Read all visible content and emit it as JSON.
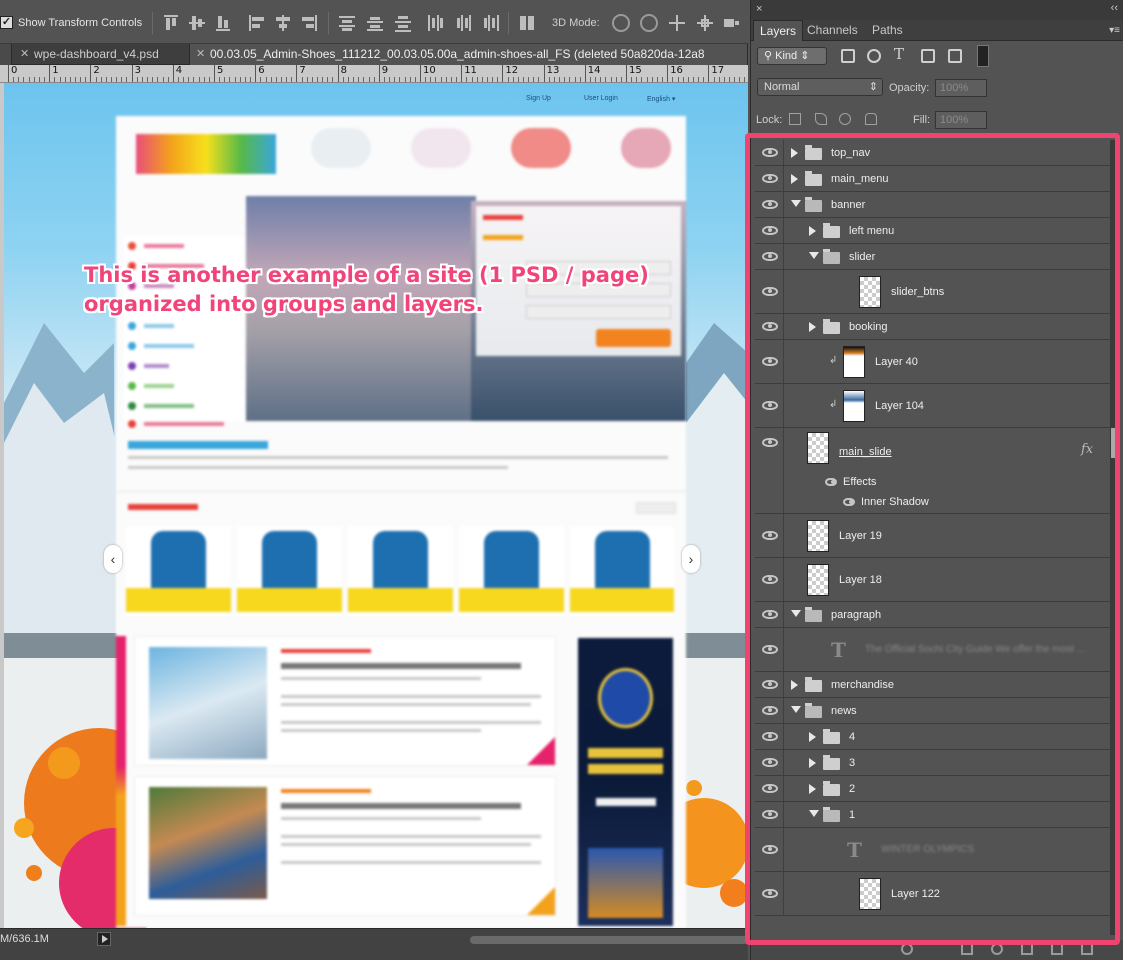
{
  "options_bar": {
    "show_transform_label": "Show Transform Controls",
    "checkbox_mark": "✓",
    "mode_label": "3D Mode:"
  },
  "doc_tabs": [
    {
      "title": "wpe-dashboard_v4.psd"
    },
    {
      "title": "00.03.05_Admin-Shoes_111212_00.03.05.00a_admin-shoes-all_FS (deleted 50a820da-12a8"
    }
  ],
  "ruler": {
    "ticks": [
      "0",
      "1",
      "2",
      "3",
      "4",
      "5",
      "6",
      "7",
      "8",
      "9",
      "10",
      "11",
      "12",
      "13",
      "14",
      "15",
      "16",
      "17",
      "1"
    ]
  },
  "canvas": {
    "annotation_line1": "This is another example of a site (1 PSD / page)",
    "annotation_line2": "organized into groups and layers.",
    "top_nav": [
      "Sign Up",
      "User Login",
      "English ▾"
    ],
    "colors": {
      "accent": "#f0447a",
      "sky": "#6cc4ee",
      "pink_border": "#f0436f"
    }
  },
  "status_bar": {
    "doc_size": "M/636.1M"
  },
  "panel": {
    "close_glyph": "×",
    "collapse_glyph": "‹‹",
    "tabs": [
      "Layers",
      "Channels",
      "Paths"
    ],
    "active_tab": "Layers",
    "filter_kind": "Kind",
    "blend_mode": "Normal",
    "opacity_label": "Opacity:",
    "opacity_value": "100%",
    "lock_label": "Lock:",
    "fill_label": "Fill:",
    "fill_value": "100%"
  },
  "layers": [
    {
      "name": "top_nav",
      "type": "group",
      "state": "collapsed",
      "indent": 0
    },
    {
      "name": "main_menu",
      "type": "group",
      "state": "collapsed",
      "indent": 0
    },
    {
      "name": "banner",
      "type": "group",
      "state": "expanded",
      "indent": 0
    },
    {
      "name": "left menu",
      "type": "group",
      "state": "collapsed",
      "indent": 1
    },
    {
      "name": "slider",
      "type": "group",
      "state": "expanded",
      "indent": 1
    },
    {
      "name": "slider_btns",
      "type": "layer",
      "indent": 2
    },
    {
      "name": "booking",
      "type": "group",
      "state": "collapsed",
      "indent": 1
    },
    {
      "name": "Layer 40",
      "type": "layer",
      "indent": 1,
      "clipped": true
    },
    {
      "name": "Layer 104",
      "type": "layer",
      "indent": 1,
      "clipped": true
    },
    {
      "name": "main_slide",
      "type": "layer",
      "indent": 0,
      "has_fx": true,
      "fx": "fx",
      "effects_label": "Effects",
      "effect": "Inner Shadow"
    },
    {
      "name": "Layer 19",
      "type": "layer",
      "indent": 0
    },
    {
      "name": "Layer 18",
      "type": "layer",
      "indent": 0
    },
    {
      "name": "paragraph",
      "type": "group",
      "state": "expanded",
      "indent": 0
    },
    {
      "name": "The Official Sochi City Guide We offer the most ...",
      "type": "text",
      "indent": 1
    },
    {
      "name": "merchandise",
      "type": "group",
      "state": "collapsed",
      "indent": 0
    },
    {
      "name": "news",
      "type": "group",
      "state": "expanded",
      "indent": 0
    },
    {
      "name": "4",
      "type": "group",
      "state": "collapsed",
      "indent": 1
    },
    {
      "name": "3",
      "type": "group",
      "state": "collapsed",
      "indent": 1
    },
    {
      "name": "2",
      "type": "group",
      "state": "collapsed",
      "indent": 1
    },
    {
      "name": "1",
      "type": "group",
      "state": "expanded",
      "indent": 1
    },
    {
      "name": "WINTER OLYMPICS",
      "type": "text",
      "indent": 2
    },
    {
      "name": "Layer 122",
      "type": "layer",
      "indent": 2
    }
  ]
}
